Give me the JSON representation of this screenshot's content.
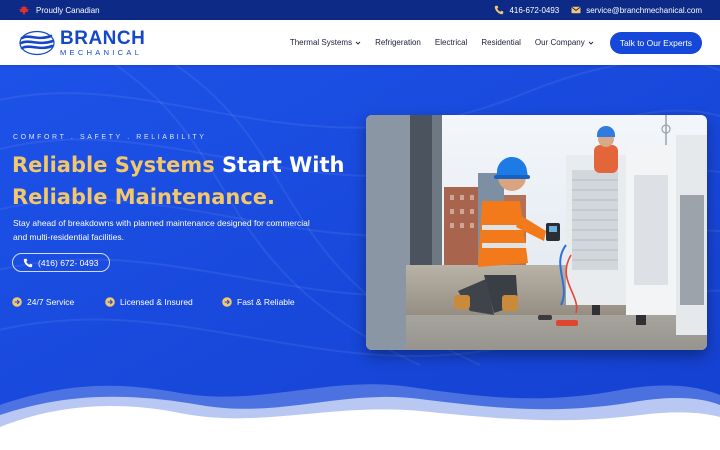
{
  "topbar": {
    "tagline": "Proudly Canadian",
    "phone": "416-672-0493",
    "email": "service@branchmechanical.com"
  },
  "header": {
    "brand": "BRANCH",
    "brand_sub": "MECHANICAL",
    "nav": [
      {
        "label": "Thermal Systems",
        "dropdown": true
      },
      {
        "label": "Refrigeration",
        "dropdown": false
      },
      {
        "label": "Electrical",
        "dropdown": false
      },
      {
        "label": "Residential",
        "dropdown": false
      },
      {
        "label": "Our Company",
        "dropdown": true
      }
    ],
    "cta": "Talk to Our Experts"
  },
  "hero": {
    "eyebrow": "COMFORT . SAFETY . RELIABILITY",
    "headline_highlight_1": "Reliable Systems",
    "headline_plain_1": " Start With",
    "headline_highlight_2": "Reliable Maintenance.",
    "description": "Stay ahead of breakdowns with planned maintenance designed for commercial and multi-residential facilities.",
    "phone_button": "(416) 672- 0493",
    "features": [
      "24/7 Service",
      "Licensed & Insured",
      "Fast & Reliable"
    ]
  },
  "colors": {
    "topbar": "#0c2a86",
    "brand_blue": "#1547c9",
    "hero_blue": "#1a4be0",
    "accent_gold": "#f3c76b"
  },
  "icons": {
    "flag": "maple-leaf-icon",
    "phone": "phone-icon",
    "email": "envelope-icon",
    "feature": "arrow-circle-icon"
  }
}
